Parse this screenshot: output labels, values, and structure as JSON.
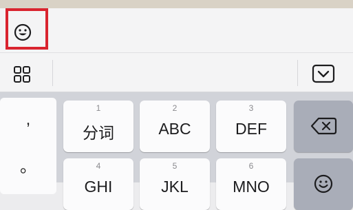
{
  "icons": {
    "emoji": "smiley-face-icon",
    "grid": "grid-four-squares-icon",
    "collapse": "keyboard-collapse-chevron-icon",
    "backspace": "backspace-x-icon",
    "emoji_key": "smiley-face-icon"
  },
  "colors": {
    "highlight_border": "#d9242f",
    "key_bg": "#fbfbfc",
    "function_key_bg": "#a9adb8",
    "keyboard_bg": "#d1d3d9"
  },
  "keyboard": {
    "punctuation": [
      ",",
      "。"
    ],
    "row1": [
      {
        "num": "1",
        "label": "分词"
      },
      {
        "num": "2",
        "label": "ABC"
      },
      {
        "num": "3",
        "label": "DEF"
      }
    ],
    "row2": [
      {
        "num": "4",
        "label": "GHI"
      },
      {
        "num": "5",
        "label": "JKL"
      },
      {
        "num": "6",
        "label": "MNO"
      }
    ]
  }
}
